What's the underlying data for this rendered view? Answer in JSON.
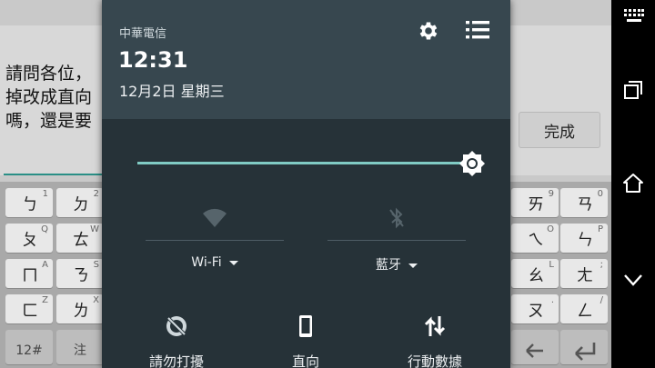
{
  "app": {
    "message_lines": [
      "請問各位，",
      "掉改成直向",
      "嗎，還是要"
    ],
    "done_label": "完成"
  },
  "keyboard": {
    "left_rows": [
      [
        {
          "main": "ㄅ",
          "sub": "1"
        },
        {
          "main": "ㄉ",
          "sub": "2"
        }
      ],
      [
        {
          "main": "ㄆ",
          "sub": "Q"
        },
        {
          "main": "ㄊ",
          "sub": "W"
        }
      ],
      [
        {
          "main": "ㄇ",
          "sub": "A"
        },
        {
          "main": "ㄋ",
          "sub": "S"
        }
      ],
      [
        {
          "main": "ㄈ",
          "sub": "Z"
        },
        {
          "main": "ㄌ",
          "sub": "X"
        }
      ]
    ],
    "right_rows": [
      [
        {
          "main": "ㄞ",
          "sub": "9"
        },
        {
          "main": "ㄢ",
          "sub": "0"
        }
      ],
      [
        {
          "main": "ㄟ",
          "sub": "O"
        },
        {
          "main": "ㄣ",
          "sub": "P"
        }
      ],
      [
        {
          "main": "ㄠ",
          "sub": "L"
        },
        {
          "main": "ㄤ",
          "sub": ";"
        }
      ],
      [
        {
          "main": "ㄡ",
          "sub": "."
        },
        {
          "main": "ㄥ",
          "sub": "/"
        }
      ]
    ],
    "bottom_left": [
      "12#",
      "注"
    ],
    "bottom_right_icons": [
      "backspace-arrow-icon",
      "enter-icon"
    ]
  },
  "shade": {
    "carrier": "中華電信",
    "clock": "12:31",
    "date": "12月2日 星期三",
    "brightness_level": 1.0,
    "tiles": {
      "wifi_label": "Wi-Fi",
      "bluetooth_label": "藍牙"
    },
    "quick_settings": {
      "dnd_label": "請勿打擾",
      "rotation_label": "直向",
      "mobile_data_label": "行動數據"
    }
  },
  "colors": {
    "shade_bg": "#263238",
    "header_bg": "#37474f",
    "accent": "#80cbc4"
  }
}
